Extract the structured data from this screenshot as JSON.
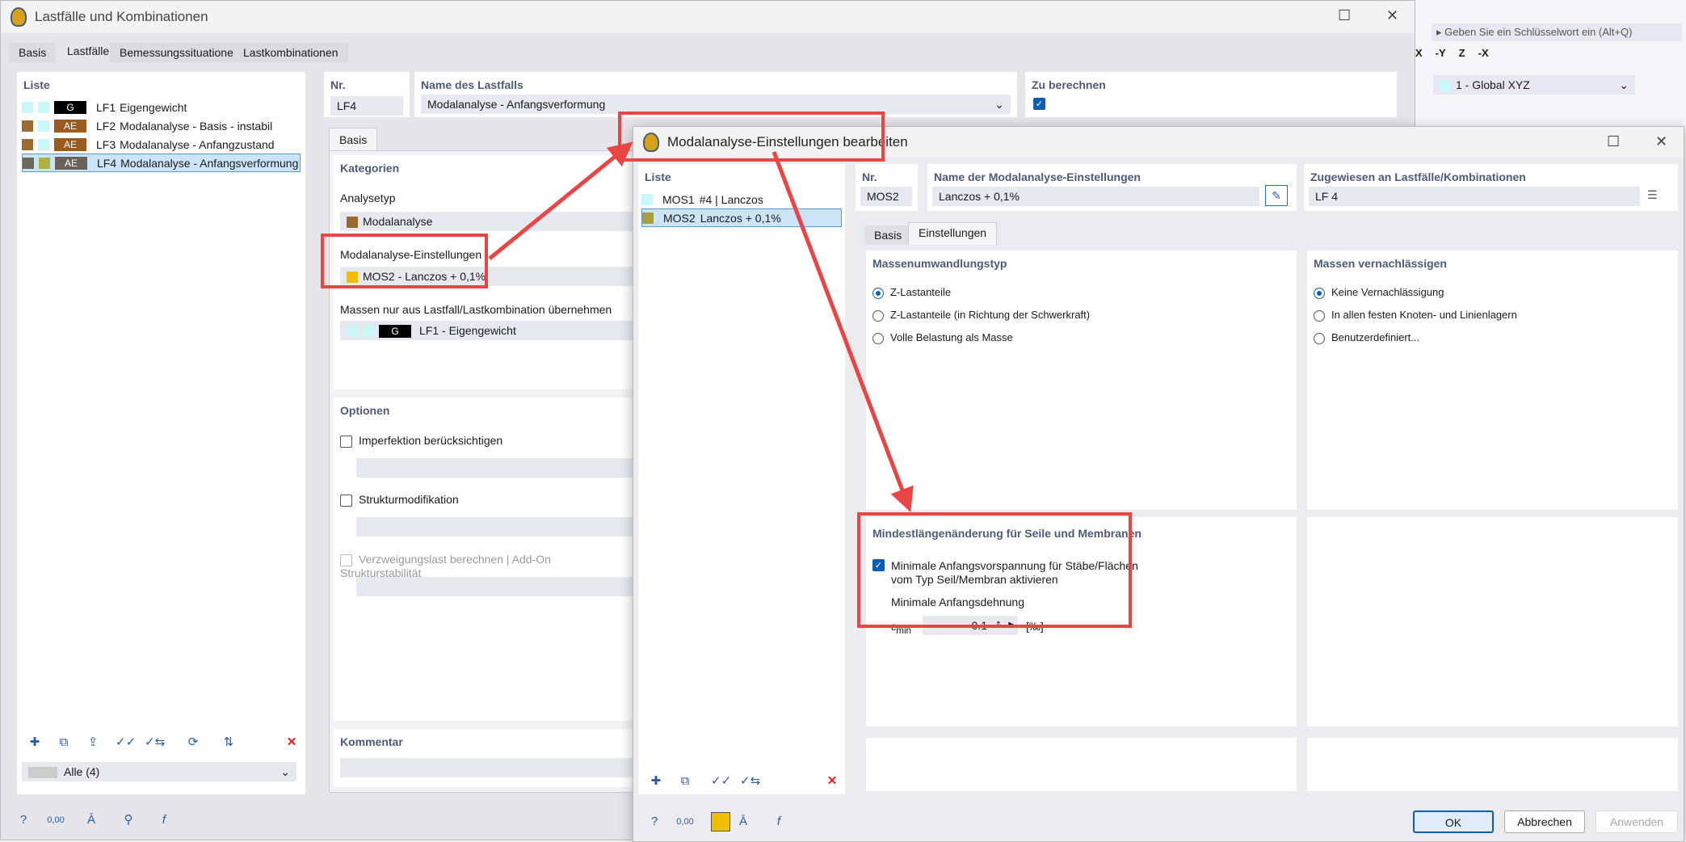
{
  "bg_app": {
    "search_placeholder": "Geben Sie ein Schlüsselwort ein (Alt+Q)",
    "coord_system": "1 - Global XYZ",
    "axis_labels": [
      "X",
      "-Y",
      "Z",
      "-X"
    ]
  },
  "main": {
    "title": "Lastfälle und Kombinationen",
    "tabs": [
      "Basis",
      "Lastfälle",
      "Bemessungssituationen",
      "Lastkombinationen"
    ],
    "active_tab": 1,
    "list_header": "Liste",
    "items": [
      {
        "c1": "#c8f8fa",
        "c2": "#c8f8fa",
        "tag": "G",
        "tagc": "#000000",
        "id": "LF1",
        "name": "Eigengewicht"
      },
      {
        "c1": "#9a6a30",
        "c2": "#c8f8fa",
        "tag": "AE",
        "tagc": "#9a5a20",
        "id": "LF2",
        "name": "Modalanalyse - Basis - instabil"
      },
      {
        "c1": "#9a6a30",
        "c2": "#c8f8fa",
        "tag": "AE",
        "tagc": "#9a5a20",
        "id": "LF3",
        "name": "Modalanalyse - Anfangzustand"
      },
      {
        "c1": "#6a6a5a",
        "c2": "#b0b040",
        "tag": "AE",
        "tagc": "#6a625a",
        "id": "LF4",
        "name": "Modalanalyse - Anfangsverformung"
      }
    ],
    "filter": "Alle (4)",
    "nr_label": "Nr.",
    "nr_value": "LF4",
    "name_label": "Name des Lastfalls",
    "name_value": "Modalanalyse - Anfangsverformung",
    "calc_label": "Zu berechnen",
    "calc_checked": true,
    "sub_tab": "Basis",
    "kategorien": "Kategorien",
    "analysetyp_label": "Analysetyp",
    "analysetyp": "Modalanalyse",
    "mos_label": "Modalanalyse-Einstellungen",
    "mos_value": "MOS2 - Lanczos + 0,1%",
    "mass_label": "Massen nur aus Lastfall/Lastkombination übernehmen",
    "mass_tag": "G",
    "mass_value": "LF1 - Eigengewicht",
    "optionen": "Optionen",
    "opt1": "Imperfektion berücksichtigen",
    "opt2": "Strukturmodifikation",
    "opt3": "Verzweigungslast berechnen | Add-On Strukturstabilität",
    "kommentar": "Kommentar"
  },
  "dialog": {
    "title": "Modalanalyse-Einstellungen bearbeiten",
    "list_header": "Liste",
    "items": [
      {
        "color": "#c8f8fa",
        "id": "MOS1",
        "name": "#4 | Lanczos"
      },
      {
        "color": "#a8a040",
        "id": "MOS2",
        "name": "Lanczos + 0,1%"
      }
    ],
    "nr_label": "Nr.",
    "nr_value": "MOS2",
    "name_label": "Name der Modalanalyse-Einstellungen",
    "name_value": "Lanczos + 0,1%",
    "assigned_label": "Zugewiesen an Lastfälle/Kombinationen",
    "assigned_value": "LF 4",
    "tabs": [
      "Basis",
      "Einstellungen"
    ],
    "active_tab": 1,
    "mass_conv": {
      "title": "Massenumwandlungstyp",
      "options": [
        "Z-Lastanteile",
        "Z-Lastanteile (in Richtung der Schwerkraft)",
        "Volle Belastung als Masse"
      ],
      "selected": 0
    },
    "mass_neglect": {
      "title": "Massen vernachlässigen",
      "options": [
        "Keine Vernachlässigung",
        "In allen festen Knoten- und Linienlagern",
        "Benutzerdefiniert..."
      ],
      "selected": 0
    },
    "min_len": {
      "title": "Mindestlängenänderung für Seile und Membranen",
      "checkbox": "Minimale Anfangsvorspannung für Stäbe/Flächen vom Typ Seil/Membran aktivieren",
      "checked": true,
      "sub": "Minimale Anfangsdehnung",
      "sym": "ε",
      "sym_sub": "min",
      "value": "0.1",
      "unit": "[‰]"
    },
    "ok": "OK",
    "cancel": "Abbrechen",
    "apply": "Anwenden"
  },
  "colors": {
    "accent": "#0a5fb4",
    "highlight": "#e84545",
    "selection": "#cce4f7",
    "mos_color": "#f0c000"
  }
}
